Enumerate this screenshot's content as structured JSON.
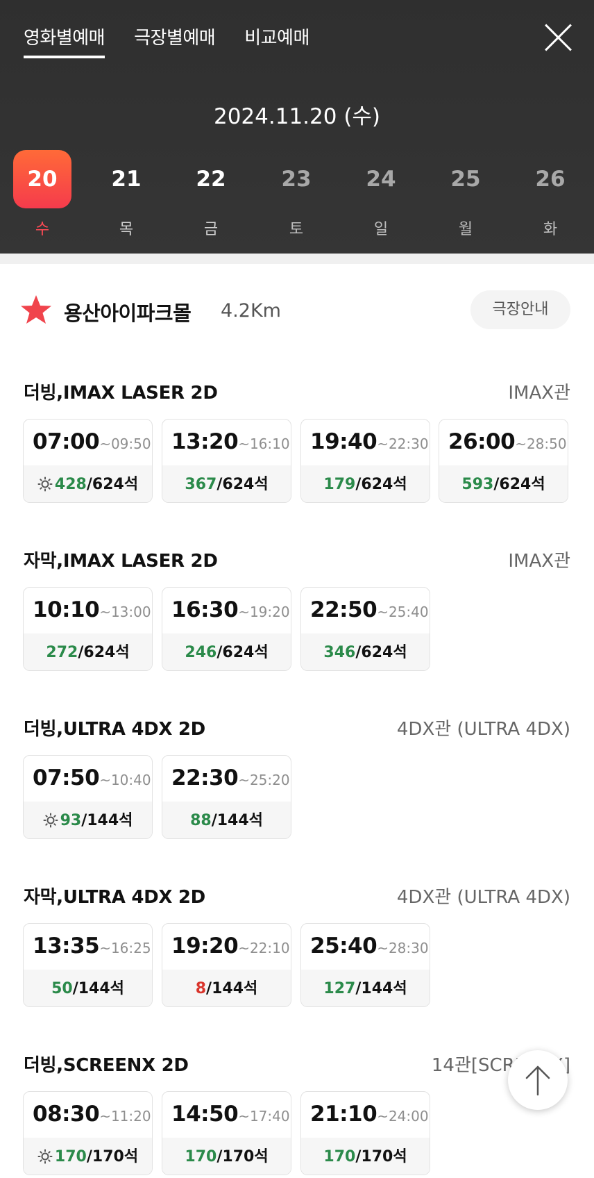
{
  "tabs": [
    {
      "label": "영화별예매",
      "active": true
    },
    {
      "label": "극장별예매",
      "active": false
    },
    {
      "label": "비교예매",
      "active": false
    }
  ],
  "date_title": "2024.11.20 (수)",
  "days": [
    {
      "num": "20",
      "weekday": "수",
      "state": "selected"
    },
    {
      "num": "21",
      "weekday": "목",
      "state": "normal"
    },
    {
      "num": "22",
      "weekday": "금",
      "state": "normal"
    },
    {
      "num": "23",
      "weekday": "토",
      "state": "dim"
    },
    {
      "num": "24",
      "weekday": "일",
      "state": "dim"
    },
    {
      "num": "25",
      "weekday": "월",
      "state": "dim"
    },
    {
      "num": "26",
      "weekday": "화",
      "state": "dim"
    }
  ],
  "theater": {
    "name": "용산아이파크몰",
    "distance": "4.2Km",
    "info_button": "극장안내",
    "favorite_icon": "star-icon"
  },
  "colors": {
    "accent": "#f53b4c",
    "available": "#2b8a4a",
    "low": "#d9342b",
    "header_bg": "#323232"
  },
  "sections": [
    {
      "title": "더빙,IMAX LASER 2D",
      "hall": "IMAX관",
      "showtimes": [
        {
          "start": "07:00",
          "end": "~09:50",
          "available": "428",
          "total": "/624석",
          "morning": true,
          "low": false
        },
        {
          "start": "13:20",
          "end": "~16:10",
          "available": "367",
          "total": "/624석",
          "morning": false,
          "low": false
        },
        {
          "start": "19:40",
          "end": "~22:30",
          "available": "179",
          "total": "/624석",
          "morning": false,
          "low": false
        },
        {
          "start": "26:00",
          "end": "~28:50",
          "available": "593",
          "total": "/624석",
          "morning": false,
          "low": false
        }
      ]
    },
    {
      "title": "자막,IMAX LASER 2D",
      "hall": "IMAX관",
      "showtimes": [
        {
          "start": "10:10",
          "end": "~13:00",
          "available": "272",
          "total": "/624석",
          "morning": false,
          "low": false
        },
        {
          "start": "16:30",
          "end": "~19:20",
          "available": "246",
          "total": "/624석",
          "morning": false,
          "low": false
        },
        {
          "start": "22:50",
          "end": "~25:40",
          "available": "346",
          "total": "/624석",
          "morning": false,
          "low": false
        }
      ]
    },
    {
      "title": "더빙,ULTRA 4DX 2D",
      "hall": "4DX관 (ULTRA 4DX)",
      "showtimes": [
        {
          "start": "07:50",
          "end": "~10:40",
          "available": "93",
          "total": "/144석",
          "morning": true,
          "low": false
        },
        {
          "start": "22:30",
          "end": "~25:20",
          "available": "88",
          "total": "/144석",
          "morning": false,
          "low": false
        }
      ]
    },
    {
      "title": "자막,ULTRA 4DX 2D",
      "hall": "4DX관 (ULTRA 4DX)",
      "showtimes": [
        {
          "start": "13:35",
          "end": "~16:25",
          "available": "50",
          "total": "/144석",
          "morning": false,
          "low": false
        },
        {
          "start": "19:20",
          "end": "~22:10",
          "available": "8",
          "total": "/144석",
          "morning": false,
          "low": true
        },
        {
          "start": "25:40",
          "end": "~28:30",
          "available": "127",
          "total": "/144석",
          "morning": false,
          "low": false
        }
      ]
    },
    {
      "title": "더빙,SCREENX 2D",
      "hall": "14관[SCREENX]",
      "showtimes": [
        {
          "start": "08:30",
          "end": "~11:20",
          "available": "170",
          "total": "/170석",
          "morning": true,
          "low": false
        },
        {
          "start": "14:50",
          "end": "~17:40",
          "available": "170",
          "total": "/170석",
          "morning": false,
          "low": false
        },
        {
          "start": "21:10",
          "end": "~24:00",
          "available": "170",
          "total": "/170석",
          "morning": false,
          "low": false
        }
      ]
    }
  ]
}
